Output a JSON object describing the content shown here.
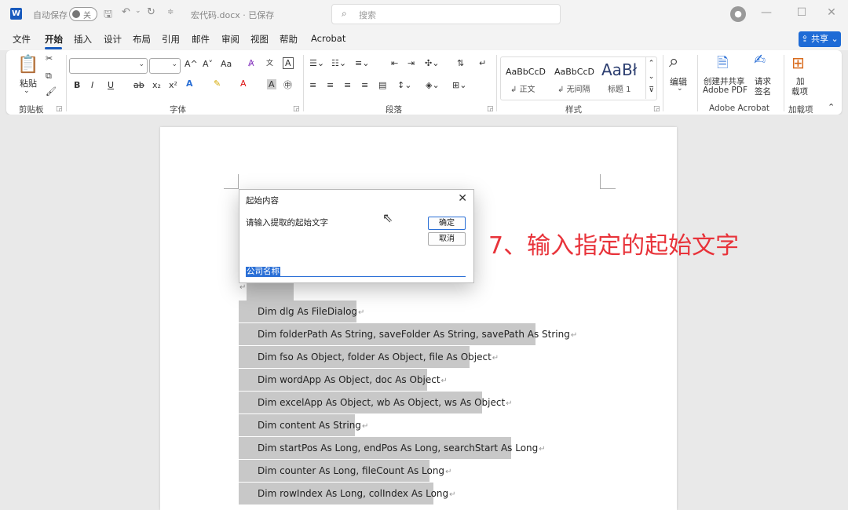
{
  "titlebar": {
    "autosave_label": "自动保存",
    "autosave_state": "关",
    "filename": "宏代码.docx · 已保存",
    "search_placeholder": "搜索"
  },
  "menu": [
    "文件",
    "开始",
    "插入",
    "设计",
    "布局",
    "引用",
    "邮件",
    "审阅",
    "视图",
    "帮助",
    "Acrobat"
  ],
  "share_label": "共享",
  "ribbon": {
    "clipboard": {
      "paste": "粘贴",
      "label": "剪贴板"
    },
    "font": {
      "label": "字体",
      "grow": "A^",
      "shrink": "A˅",
      "case": "Aa",
      "bold": "B",
      "italic": "I",
      "underline": "U",
      "strike": "ab",
      "sub": "x₂",
      "sup": "x²"
    },
    "paragraph": {
      "label": "段落"
    },
    "styles": {
      "label": "样式",
      "items": [
        {
          "preview": "AaBbCcD",
          "name": "正文"
        },
        {
          "preview": "AaBbCcD",
          "name": "无间隔"
        },
        {
          "preview": "AaBł",
          "name": "标题 1"
        }
      ]
    },
    "edit": {
      "label": "编辑"
    },
    "acrobat": {
      "create_label_1": "创建并共享",
      "create_label_2": "Adobe PDF",
      "sign_label_1": "请求",
      "sign_label_2": "签名",
      "group_label": "Adobe Acrobat"
    },
    "addins": {
      "btn_1": "加",
      "btn_2": "载项",
      "label": "加载项"
    }
  },
  "dialog": {
    "title": "起始内容",
    "prompt": "请输入提取的起始文字",
    "ok": "确定",
    "cancel": "取消",
    "input_value": "公司名称"
  },
  "annotation": "7、输入指定的起始文字",
  "code_lines": [
    "Dim dlg As FileDialog",
    "Dim folderPath As String, saveFolder As String, savePath As String",
    "Dim fso As Object, folder As Object, file As Object",
    "Dim wordApp As Object, doc As Object",
    "Dim excelApp As Object, wb As Object, ws As Object",
    "Dim content As String",
    "Dim startPos As Long, endPos As Long, searchStart As Long",
    "Dim counter As Long, fileCount As Long",
    "Dim rowIndex As Long, colIndex As Long"
  ],
  "colors": {
    "accent": "#185abd",
    "annotation": "#e8333a",
    "highlight": "#c8c8c8"
  }
}
